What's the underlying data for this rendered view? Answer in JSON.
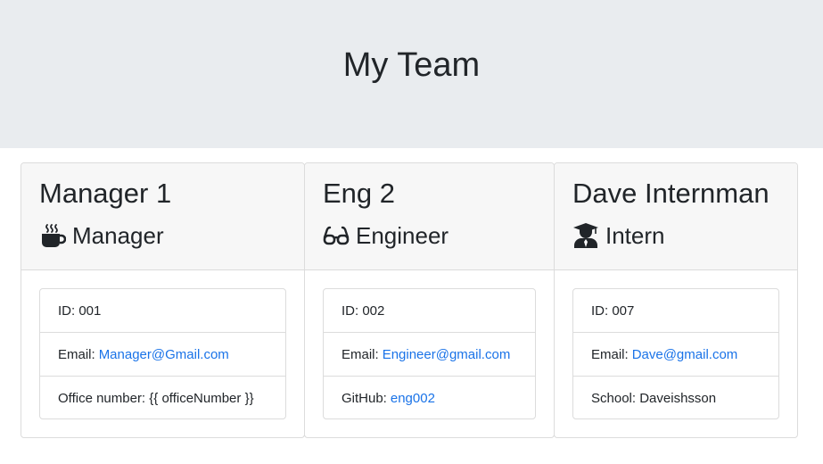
{
  "header": {
    "title": "My Team"
  },
  "cards": [
    {
      "name": "Manager 1",
      "role": "Manager",
      "role_icon": "mug-hot-icon",
      "items": [
        {
          "label": "ID:",
          "value": "001"
        },
        {
          "label": "Email:",
          "link": "Manager@Gmail.com"
        },
        {
          "label": "Office number:",
          "value": "{{ officeNumber }}"
        }
      ]
    },
    {
      "name": "Eng 2",
      "role": "Engineer",
      "role_icon": "glasses-icon",
      "items": [
        {
          "label": "ID:",
          "value": "002"
        },
        {
          "label": "Email:",
          "link": "Engineer@gmail.com"
        },
        {
          "label": "GitHub:",
          "link": "eng002"
        }
      ]
    },
    {
      "name": "Dave Internman",
      "role": "Intern",
      "role_icon": "user-graduate-icon",
      "items": [
        {
          "label": "ID:",
          "value": "007"
        },
        {
          "label": "Email:",
          "link": "Dave@gmail.com"
        },
        {
          "label": "School:",
          "value": "Daveishsson"
        }
      ]
    }
  ],
  "colors": {
    "link": "#1a73e8",
    "header_bg": "#e9ecef",
    "card_header_bg": "#f7f7f7"
  }
}
